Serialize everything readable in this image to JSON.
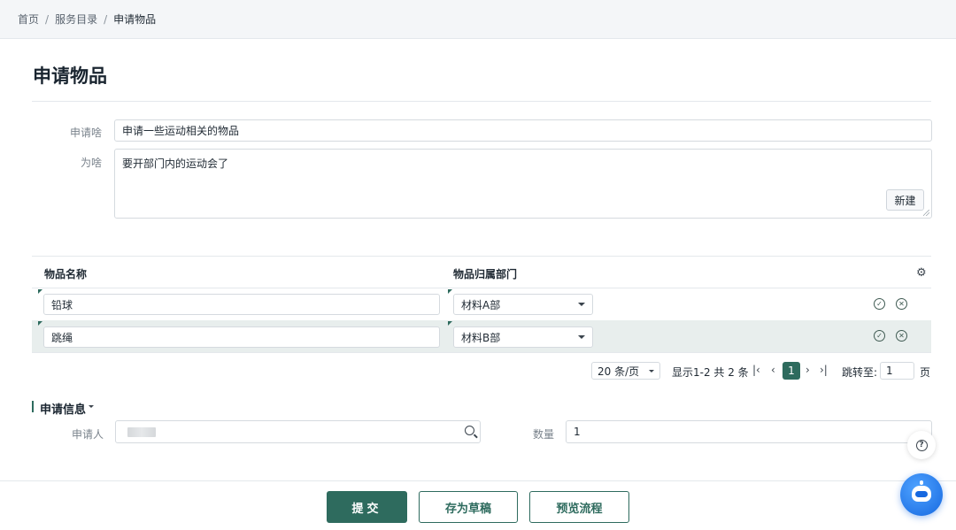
{
  "breadcrumb": {
    "home": "首页",
    "catalog": "服务目录",
    "current": "申请物品",
    "separator": "/"
  },
  "page": {
    "title": "申请物品"
  },
  "form": {
    "what_label": "申请啥",
    "what_value": "申请一些运动相关的物品",
    "why_label": "为啥",
    "why_value": "要开部门内的运动会了"
  },
  "table": {
    "new_button": "新建",
    "columns": [
      "物品名称",
      "物品归属部门"
    ],
    "rows": [
      {
        "name": "铅球",
        "dept": "材料A部"
      },
      {
        "name": "跳绳",
        "dept": "材料B部"
      }
    ],
    "settings_icon": "gear-icon",
    "confirm_icon": "check-circle-icon",
    "delete_icon": "close-circle-icon"
  },
  "pager": {
    "page_size": "20 条/页",
    "summary": "显示1-2 共 2 条",
    "first": "|‹",
    "prev": "‹",
    "current_page": "1",
    "next": "›",
    "last": "›|",
    "jump_label": "跳转至:",
    "jump_value": "1",
    "page_suffix": "页"
  },
  "section": {
    "title": "申请信息",
    "applicant_label": "申请人",
    "quantity_label": "数量",
    "quantity_value": "1"
  },
  "footer": {
    "submit": "提交",
    "save_draft": "存为草稿",
    "preview": "预览流程"
  },
  "floating": {
    "help_glyph": "?",
    "assistant_icon": "robot-assistant-icon"
  },
  "colors": {
    "primary": "#2e6b5e",
    "assistant": "#1668e0",
    "row_highlight": "#e8eeed"
  }
}
